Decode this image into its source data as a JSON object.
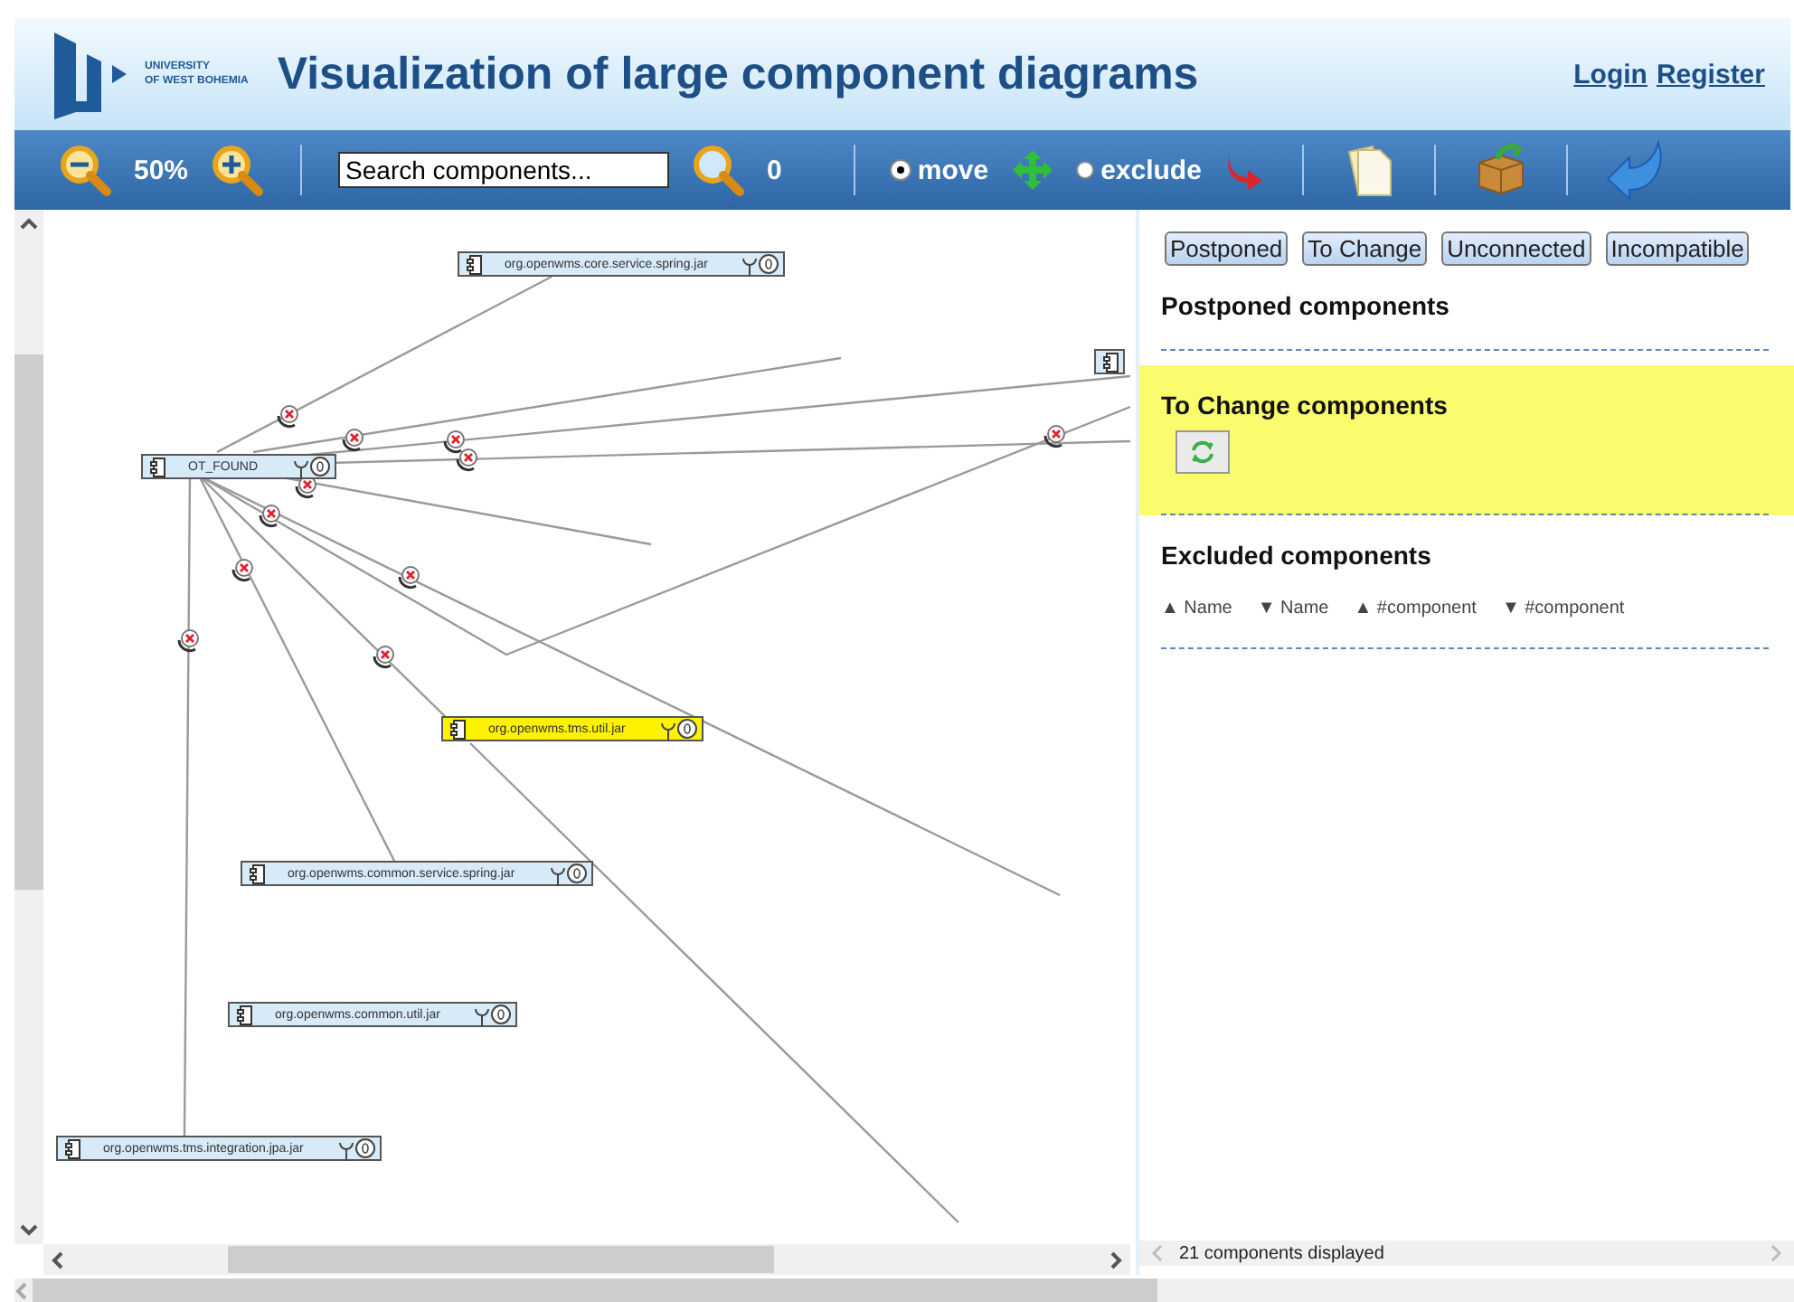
{
  "header": {
    "logo_lines": [
      "UNIVERSITY",
      "OF WEST BOHEMIA"
    ],
    "title": "Visualization of large component diagrams",
    "links": [
      "Login",
      "Register"
    ]
  },
  "toolbar": {
    "zoom": "50%",
    "search": {
      "value": "Search components..."
    },
    "result_count": "0",
    "modes": [
      {
        "label": "move",
        "selected": true
      },
      {
        "label": "exclude",
        "selected": false
      }
    ]
  },
  "diagram": {
    "nodes": [
      {
        "label": "org.openwms.core.service.spring.jar",
        "highlighted": false
      },
      {
        "kind": "cut",
        "highlighted": false
      },
      {
        "label": "OT_FOUND",
        "highlighted": false
      },
      {
        "label": "org.openwms.tms.util.jar",
        "highlighted": true
      },
      {
        "label": "org.openwms.common.service.spring.jar",
        "highlighted": false
      },
      {
        "label": "org.openwms.common.util.jar",
        "highlighted": false
      },
      {
        "label": "org.openwms.tms.integration.jpa.jar",
        "highlighted": false
      }
    ]
  },
  "panel": {
    "filters": [
      "Postponed",
      "To Change",
      "Unconnected",
      "Incompatible"
    ],
    "sections": [
      {
        "kind": "list",
        "title": "Postponed components"
      },
      {
        "kind": "highlight",
        "title": "To Change components"
      },
      {
        "kind": "table",
        "title": "Excluded components",
        "sort_headers": [
          {
            "arrow": "▲",
            "label": "Name"
          },
          {
            "arrow": "▼",
            "label": "Name"
          },
          {
            "arrow": "▲",
            "label": "#component"
          },
          {
            "arrow": "▼",
            "label": "#component"
          }
        ]
      }
    ],
    "status": "21 components displayed"
  }
}
